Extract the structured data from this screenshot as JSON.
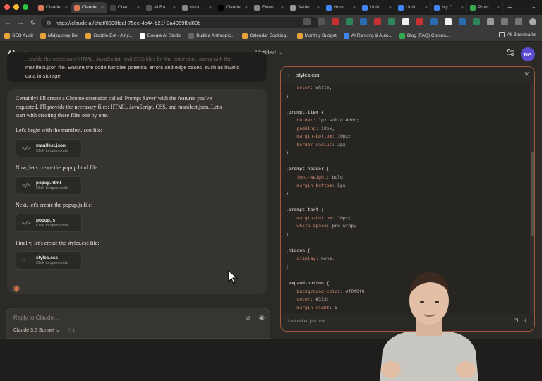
{
  "browser": {
    "tabs": [
      {
        "label": "Claude",
        "color": "#d97757",
        "active": false
      },
      {
        "label": "Claude",
        "color": "#d97757",
        "active": true
      },
      {
        "label": "Chat",
        "color": "#444444",
        "active": false
      },
      {
        "label": "AI Ra",
        "color": "#555555",
        "active": false
      },
      {
        "label": "claud",
        "color": "#888888",
        "active": false
      },
      {
        "label": "Claude",
        "color": "#000000",
        "active": false
      },
      {
        "label": "Exten",
        "color": "#888888",
        "active": false
      },
      {
        "label": "Settin",
        "color": "#999999",
        "active": false
      },
      {
        "label": "Hom",
        "color": "#4285f4",
        "active": false
      },
      {
        "label": "Untit",
        "color": "#4285f4",
        "active": false
      },
      {
        "label": "Untit",
        "color": "#4285f4",
        "active": false
      },
      {
        "label": "My D",
        "color": "#4285f4",
        "active": false
      },
      {
        "label": "Prom",
        "color": "#34a853",
        "active": false
      }
    ],
    "url": "https://claude.ai/chat/0390fdaf-75ee-4c44-b21f-3a4959f0d80b",
    "bookmarks": [
      {
        "label": "SEO Audit",
        "color": "#e8a33c"
      },
      {
        "label": "Midjourney Bot",
        "color": "#e8a33c"
      },
      {
        "label": "Gobble Bot - All y...",
        "color": "#e8a33c"
      },
      {
        "label": "Google AI Studio",
        "color": "#ffffff"
      },
      {
        "label": "Build a Anthropic...",
        "color": "#666666"
      },
      {
        "label": "Calendar Booking...",
        "color": "#e8a33c"
      },
      {
        "label": "Monthly Budget",
        "color": "#e8a33c"
      },
      {
        "label": "AI Ranking & Auto...",
        "color": "#4285f4"
      },
      {
        "label": "Blog (FAQ) Conten...",
        "color": "#34a853"
      }
    ],
    "all_bookmarks": "All Bookmarks"
  },
  "app": {
    "title": "Untitled",
    "avatar": "NG",
    "user_message": {
      "line1": "...ovide the necessary HTML, JavaScript, and CSS files for the extension, along with the",
      "line2": "manifest.json file. Ensure the code handles potential errors and edge cases, such as invalid",
      "line3": "data in storage."
    },
    "assistant": {
      "intro1": "Certainly! I'll create a Chrome extension called 'Prompt Saver' with the features you've",
      "intro2": "requested. I'll provide the necessary files: HTML, JavaScript, CSS, and manifest.json. Let's",
      "intro3": "start with creating these files one by one.",
      "p1": "Let's begin with the manifest.json file:",
      "p2": "Now, let's create the popup.html file:",
      "p3": "Next, let's create the popup.js file:",
      "p4": "Finally, let's create the styles.css file:",
      "artifacts": [
        {
          "name": "manifest.json",
          "sub": "Click to open code"
        },
        {
          "name": "popup.html",
          "sub": "Click to open code"
        },
        {
          "name": "popup.js",
          "sub": "Click to open code"
        },
        {
          "name": "styles.css",
          "sub": "Click to open code"
        }
      ]
    },
    "composer": {
      "placeholder": "Reply to Claude...",
      "model": "Claude 3.5 Sonnet",
      "model_extra": "1"
    }
  },
  "panel": {
    "filename": "styles.css",
    "footer": "Last edited just now",
    "code_lines": [
      {
        "t": "    color: white;",
        "k": "prop"
      },
      {
        "t": "}",
        "k": "sel"
      },
      {
        "t": "",
        "k": "sel"
      },
      {
        "t": ".prompt-item {",
        "k": "sel"
      },
      {
        "t": "    border: 1px solid #ddd;",
        "k": "prop"
      },
      {
        "t": "    padding: 10px;",
        "k": "prop"
      },
      {
        "t": "    margin-bottom: 10px;",
        "k": "prop"
      },
      {
        "t": "    border-radius: 3px;",
        "k": "prop"
      },
      {
        "t": "}",
        "k": "sel"
      },
      {
        "t": "",
        "k": "sel"
      },
      {
        "t": ".prompt-header {",
        "k": "sel"
      },
      {
        "t": "    font-weight: bold;",
        "k": "prop"
      },
      {
        "t": "    margin-bottom: 5px;",
        "k": "prop"
      },
      {
        "t": "}",
        "k": "sel"
      },
      {
        "t": "",
        "k": "sel"
      },
      {
        "t": ".prompt-text {",
        "k": "sel"
      },
      {
        "t": "    margin-bottom: 10px;",
        "k": "prop"
      },
      {
        "t": "    white-space: pre-wrap;",
        "k": "prop"
      },
      {
        "t": "}",
        "k": "sel"
      },
      {
        "t": "",
        "k": "sel"
      },
      {
        "t": ".hidden {",
        "k": "sel"
      },
      {
        "t": "    display: none;",
        "k": "prop"
      },
      {
        "t": "}",
        "k": "sel"
      },
      {
        "t": "",
        "k": "sel"
      },
      {
        "t": ".expand-button {",
        "k": "sel"
      },
      {
        "t": "    background-color: #f0f0f0;",
        "k": "prop"
      },
      {
        "t": "    color: #333;",
        "k": "prop"
      },
      {
        "t": "    margin-right: 5",
        "k": "prop"
      }
    ]
  }
}
